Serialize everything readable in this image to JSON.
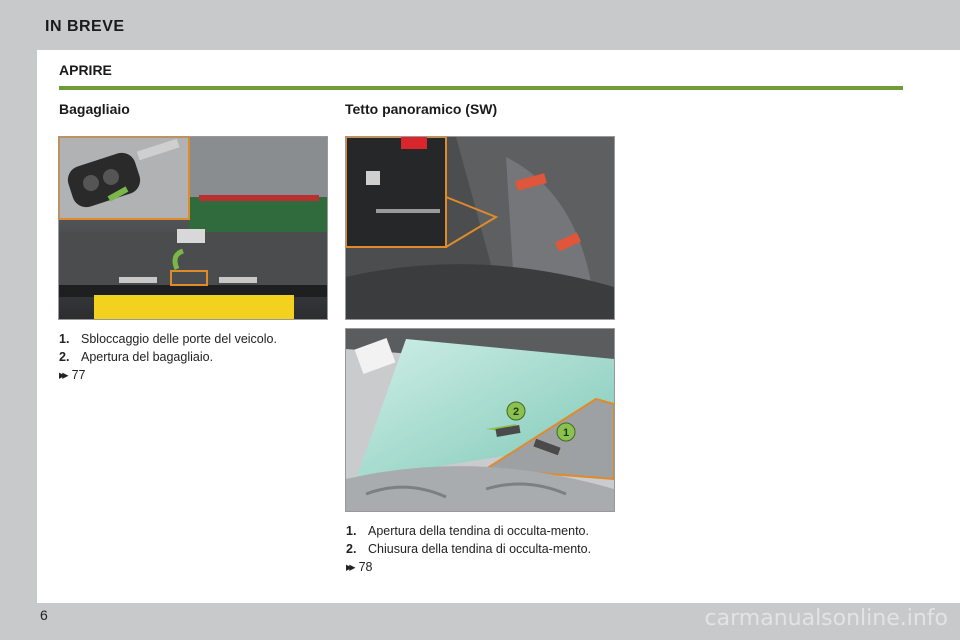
{
  "header": {
    "title": "IN BREVE"
  },
  "section": {
    "title": "APRIRE"
  },
  "left": {
    "title": "Bagagliaio",
    "items": [
      {
        "num": "1.",
        "text": "Sbloccaggio delle porte del veicolo."
      },
      {
        "num": "2.",
        "text": "Apertura del bagagliaio."
      }
    ],
    "ref": "77"
  },
  "right": {
    "title": "Tetto panoramico (SW)",
    "items": [
      {
        "num": "1.",
        "text": "Apertura della tendina di occulta-mento."
      },
      {
        "num": "2.",
        "text": "Chiusura della tendina di occulta-mento."
      }
    ],
    "ref": "78"
  },
  "callouts": {
    "one": "1",
    "two": "2"
  },
  "footer": {
    "page": "6",
    "watermark": "carmanualsonline.info"
  }
}
